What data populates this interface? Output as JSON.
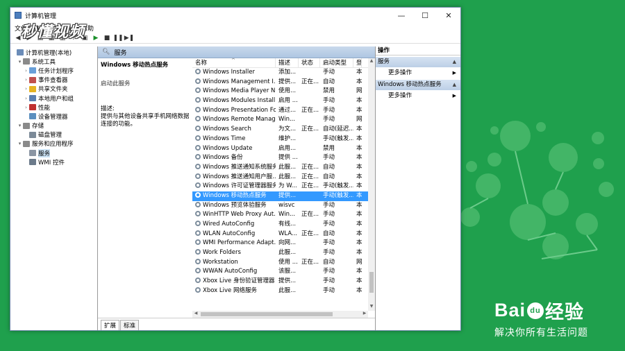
{
  "window": {
    "title": "计算机管理"
  },
  "watermark": "秒懂视频",
  "menu": [
    "文件",
    "操作",
    "查看",
    "帮助"
  ],
  "toolbar_icons": [
    "back-icon",
    "forward-icon",
    "up-icon",
    "show-hide-icon",
    "properties-icon",
    "help-icon",
    "export-icon",
    "play-icon",
    "stop-icon",
    "pause-icon",
    "restart-icon"
  ],
  "tree": [
    {
      "label": "计算机管理(本地)",
      "level": 0,
      "arrow": "",
      "icon": "computer-icon",
      "color": "#6b8cb8"
    },
    {
      "label": "系统工具",
      "level": 1,
      "arrow": "▾",
      "icon": "tools-icon",
      "color": "#8a8a8a"
    },
    {
      "label": "任务计划程序",
      "level": 2,
      "arrow": "›",
      "icon": "clock-icon",
      "color": "#6aa0d8"
    },
    {
      "label": "事件查看器",
      "level": 2,
      "arrow": "›",
      "icon": "event-icon",
      "color": "#c0504d"
    },
    {
      "label": "共享文件夹",
      "level": 2,
      "arrow": "›",
      "icon": "folder-icon",
      "color": "#e6b422"
    },
    {
      "label": "本地用户和组",
      "level": 2,
      "arrow": "›",
      "icon": "users-icon",
      "color": "#5a7fb0"
    },
    {
      "label": "性能",
      "level": 2,
      "arrow": "›",
      "icon": "performance-icon",
      "color": "#c03030"
    },
    {
      "label": "设备管理器",
      "level": 2,
      "arrow": "",
      "icon": "device-icon",
      "color": "#5b8fbf"
    },
    {
      "label": "存储",
      "level": 1,
      "arrow": "▾",
      "icon": "storage-icon",
      "color": "#8a8a8a"
    },
    {
      "label": "磁盘管理",
      "level": 2,
      "arrow": "",
      "icon": "disk-icon",
      "color": "#7c8a98"
    },
    {
      "label": "服务和应用程序",
      "level": 1,
      "arrow": "▾",
      "icon": "services-apps-icon",
      "color": "#8a8a8a"
    },
    {
      "label": "服务",
      "level": 2,
      "arrow": "",
      "icon": "gear-icon",
      "color": "#8a95a3",
      "selected": true
    },
    {
      "label": "WMI 控件",
      "level": 2,
      "arrow": "",
      "icon": "wmi-icon",
      "color": "#6b7a8a"
    }
  ],
  "services_header": "服务",
  "detail": {
    "title": "Windows 移动热点服务",
    "link": "启动此服务",
    "desc_label": "描述:",
    "desc_text": "提供与其他设备共享手机网络数据连接的功能。"
  },
  "columns": [
    "名称",
    "描述",
    "状态",
    "启动类型",
    "登"
  ],
  "rows": [
    [
      "Windows Installer",
      "添加...",
      "",
      "手动",
      "本"
    ],
    [
      "Windows Management I...",
      "提供...",
      "正在...",
      "自动",
      "本"
    ],
    [
      "Windows Media Player N...",
      "使用...",
      "",
      "禁用",
      "网"
    ],
    [
      "Windows Modules Install...",
      "启用 ...",
      "",
      "手动",
      "本"
    ],
    [
      "Windows Presentation Fo...",
      "通过...",
      "正在...",
      "手动",
      "本"
    ],
    [
      "Windows Remote Manag...",
      "Win...",
      "",
      "手动",
      "网"
    ],
    [
      "Windows Search",
      "为文...",
      "正在...",
      "自动(延迟...",
      "本"
    ],
    [
      "Windows Time",
      "维护...",
      "",
      "手动(触发...",
      "本"
    ],
    [
      "Windows Update",
      "启用...",
      "",
      "禁用",
      "本"
    ],
    [
      "Windows 备份",
      "提供 ...",
      "",
      "手动",
      "本"
    ],
    [
      "Windows 推送通知系统服务",
      "此服...",
      "正在...",
      "自动",
      "本"
    ],
    [
      "Windows 推送通知用户服...",
      "此服...",
      "正在...",
      "自动",
      "本"
    ],
    [
      "Windows 许可证管理器服务",
      "为 W...",
      "正在...",
      "手动(触发...",
      "本"
    ],
    [
      "Windows 移动热点服务",
      "提供...",
      "",
      "手动(触发...",
      "本"
    ],
    [
      "Windows 预览体验服务",
      "wisvc",
      "",
      "手动",
      "本"
    ],
    [
      "WinHTTP Web Proxy Aut...",
      "Win...",
      "正在...",
      "手动",
      "本"
    ],
    [
      "Wired AutoConfig",
      "有线...",
      "",
      "手动",
      "本"
    ],
    [
      "WLAN AutoConfig",
      "WLA...",
      "正在...",
      "自动",
      "本"
    ],
    [
      "WMI Performance Adapt...",
      "向网...",
      "",
      "手动",
      "本"
    ],
    [
      "Work Folders",
      "此服...",
      "",
      "手动",
      "本"
    ],
    [
      "Workstation",
      "使用 ...",
      "正在...",
      "自动",
      "网"
    ],
    [
      "WWAN AutoConfig",
      "该服...",
      "",
      "手动",
      "本"
    ],
    [
      "Xbox Live 身份验证管理器",
      "提供...",
      "",
      "手动",
      "本"
    ],
    [
      "Xbox Live 网络服务",
      "此服...",
      "",
      "手动",
      "本"
    ]
  ],
  "selected_row": 13,
  "tabs": [
    "扩展",
    "标准"
  ],
  "actions": {
    "header": "操作",
    "sections": [
      {
        "title": "服务",
        "item": "更多操作"
      },
      {
        "title": "Windows 移动热点服务",
        "item": "更多操作"
      }
    ]
  },
  "brand": {
    "logo_left": "Bai",
    "logo_mid": "du",
    "logo_right": "经验",
    "tagline": "解决你所有生活问题"
  },
  "colors": {
    "background": "#1fa04d",
    "selection": "#3399ff",
    "header": "#aec6e2"
  }
}
